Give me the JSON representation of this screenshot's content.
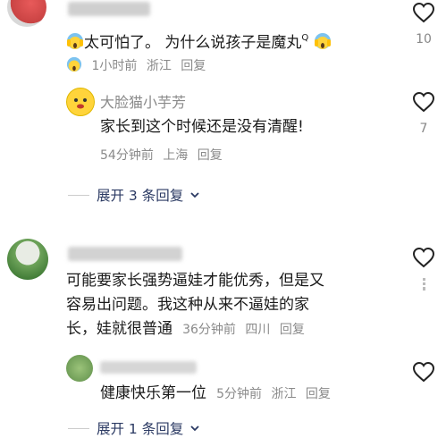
{
  "comments": [
    {
      "text_a": "太可怕了。 为什么说孩子是魔丸",
      "time": "1小时前",
      "location": "浙江",
      "reply_label": "回复",
      "likes": "10"
    },
    {
      "username": "大脸猫小芋芳",
      "text": "家长到这个时候还是没有清醒!",
      "time": "54分钟前",
      "location": "上海",
      "reply_label": "回复",
      "likes": "7"
    },
    {
      "expand_label": "展开 3 条回复"
    },
    {
      "text_line1": "可能要家长强势逼娃才能优秀，但是又",
      "text_line2": "容易出问题。我这种从来不逼娃的家",
      "text_line3": "长，娃就很普通",
      "time": "36分钟前",
      "location": "四川",
      "reply_label": "回复"
    },
    {
      "text": "健康快乐第一位",
      "time": "5分钟前",
      "location": "浙江",
      "reply_label": "回复"
    },
    {
      "expand_label": "展开 1 条回复"
    }
  ],
  "icons": {
    "like": "heart-outline-icon",
    "emoji_scream": "scream-emoji-icon",
    "accent": "#2b3a63",
    "meta_color": "#8a8a8a"
  }
}
